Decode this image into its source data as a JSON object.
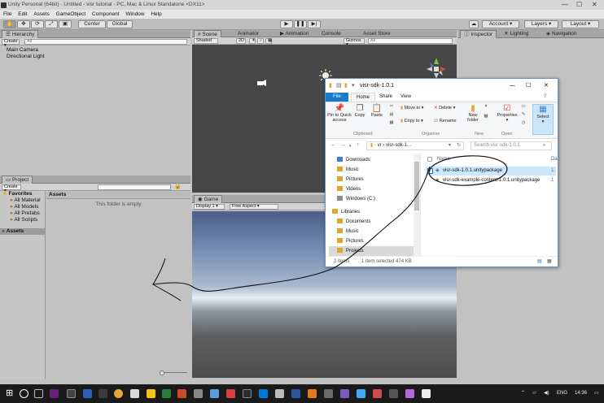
{
  "window": {
    "title": "Unity Personal (64bit) - Untitled - visr tutorial - PC, Mac & Linux Standalone <DX11>",
    "minimize": "—",
    "maximize": "☐",
    "close": "✕"
  },
  "menu": [
    "File",
    "Edit",
    "Assets",
    "GameObject",
    "Component",
    "Window",
    "Help"
  ],
  "toolbar": {
    "pivot": "Center",
    "space": "Global",
    "account": "Account",
    "layers": "Layers",
    "layout": "Layout"
  },
  "hierarchy": {
    "tab": "Hierarchy",
    "create": "Create",
    "search_placeholder": "All",
    "items": [
      "Main Camera",
      "Directional Light"
    ]
  },
  "scene_tabs": [
    "Scene",
    "Animator",
    "Animation",
    "Console",
    "Asset Store"
  ],
  "scene_bar": {
    "shading": "Shaded",
    "mode": "2D",
    "gizmos": "Gizmos",
    "search_placeholder": "All"
  },
  "inspector_tabs": [
    "Inspector",
    "Lighting",
    "Navigation"
  ],
  "project": {
    "tab": "Project",
    "create": "Create",
    "favorites_label": "Favorites",
    "favorites": [
      "All Material",
      "All Models",
      "All Prefabs",
      "All Scripts"
    ],
    "assets_label": "Assets",
    "assets_header": "Assets",
    "empty_text": "This folder is empty"
  },
  "game": {
    "tab": "Game",
    "display": "Display 1",
    "aspect": "Free Aspect"
  },
  "explorer": {
    "title": "visr-sdk-1.0.1",
    "tabs": [
      "File",
      "Home",
      "Share",
      "View"
    ],
    "ribbon": {
      "pin": "Pin to Quick access",
      "copy": "Copy",
      "paste": "Paste",
      "clipboard": "Clipboard",
      "move_to": "Move to",
      "delete": "Delete",
      "copy_to": "Copy to",
      "rename": "Rename",
      "organise": "Organise",
      "new_folder": "New folder",
      "new": "New",
      "properties": "Properties",
      "open": "Open",
      "select": "Select"
    },
    "path": [
      "vr",
      "visr-sdk-1..."
    ],
    "search_placeholder": "Search visr-sdk-1.0.1",
    "nav": [
      {
        "label": "Downloads",
        "color": "#3b7fd1"
      },
      {
        "label": "Music",
        "color": "#e0a62c"
      },
      {
        "label": "Pictures",
        "color": "#e0a62c"
      },
      {
        "label": "Videos",
        "color": "#e0a62c"
      },
      {
        "label": "Windows (C:)",
        "color": "#8c8c8c"
      },
      {
        "label": "Libraries",
        "color": "#e0a62c"
      },
      {
        "label": "Documents",
        "color": "#e0a62c"
      },
      {
        "label": "Music",
        "color": "#e0a62c"
      },
      {
        "label": "Pictures",
        "color": "#e0a62c"
      },
      {
        "label": "Projects",
        "color": "#e0a62c"
      }
    ],
    "column_name": "Name",
    "column_date": "Da",
    "files": [
      {
        "name": "visr-sdk-1.0.1.unitypackage",
        "date": "1.",
        "selected": true
      },
      {
        "name": "visr-sdk-example-content-1.0.1.unitypackage",
        "date": "1.",
        "selected": false
      }
    ],
    "status_items": "2 items",
    "status_selected": "1 item selected  474 KB"
  },
  "taskbar": {
    "lang": "ENG",
    "time": "14:36"
  }
}
